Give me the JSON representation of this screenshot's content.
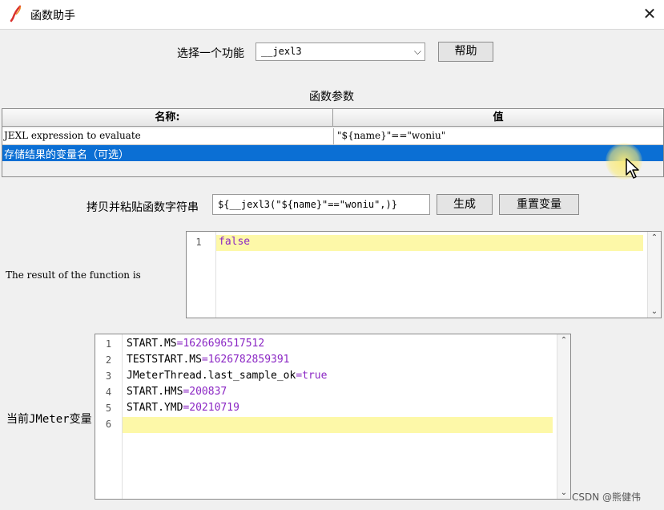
{
  "window": {
    "title": "函数助手",
    "close_glyph": "✕"
  },
  "selector": {
    "label": "选择一个功能",
    "value": "__jexl3",
    "help_button": "帮助"
  },
  "params": {
    "title": "函数参数",
    "columns": [
      "名称:",
      "值"
    ],
    "rows": [
      {
        "name": "JEXL expression to evaluate",
        "value": "\"${name}\"==\"woniu\""
      },
      {
        "name": "存储结果的变量名（可选）",
        "value": ""
      }
    ],
    "selected_row_color": "#0b6fd4"
  },
  "copy": {
    "label": "拷贝并粘贴函数字符串",
    "value": "${__jexl3(\"${name}\"==\"woniu\",)}",
    "generate_button": "生成",
    "reset_button": "重置变量"
  },
  "result": {
    "label": "The result of the function is",
    "lines": [
      {
        "num": "1",
        "text": "false"
      }
    ]
  },
  "vars": {
    "label": "当前JMeter变量",
    "lines": [
      {
        "num": "1",
        "key": "START.MS",
        "eq": "=",
        "val": "1626696517512"
      },
      {
        "num": "2",
        "key": "TESTSTART.MS",
        "eq": "=",
        "val": "1626782859391"
      },
      {
        "num": "3",
        "key": "JMeterThread.last_sample_ok",
        "eq": "=",
        "val": "true"
      },
      {
        "num": "4",
        "key": "START.HMS",
        "eq": "=",
        "val": "200837"
      },
      {
        "num": "5",
        "key": "START.YMD",
        "eq": "=",
        "val": "20210719"
      },
      {
        "num": "6",
        "key": "",
        "eq": "",
        "val": ""
      }
    ]
  },
  "icons": {
    "app": "feather-pen-icon",
    "close": "close-icon",
    "dropdown": "chevron-down-icon",
    "cursor": "mouse-pointer-icon"
  },
  "colors": {
    "value_purple": "#8b27c4",
    "current_line": "#fdf8a8"
  },
  "watermark": "CSDN @熊健伟"
}
